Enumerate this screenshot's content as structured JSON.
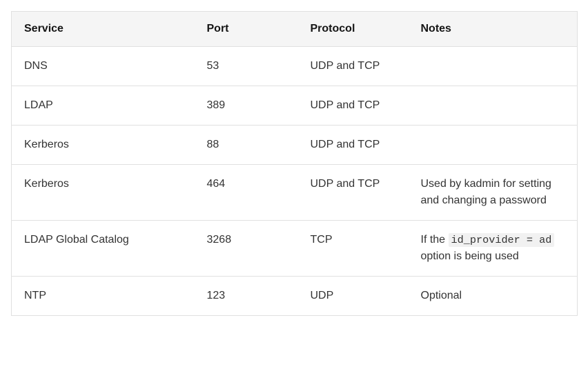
{
  "table": {
    "headers": {
      "service": "Service",
      "port": "Port",
      "protocol": "Protocol",
      "notes": "Notes"
    },
    "rows": {
      "r0": {
        "service": "DNS",
        "port": "53",
        "protocol": "UDP and TCP",
        "notes": ""
      },
      "r1": {
        "service": "LDAP",
        "port": "389",
        "protocol": "UDP and TCP",
        "notes": ""
      },
      "r2": {
        "service": "Kerberos",
        "port": "88",
        "protocol": "UDP and TCP",
        "notes": ""
      },
      "r3": {
        "service": "Kerberos",
        "port": "464",
        "protocol": "UDP and TCP",
        "notes": "Used by kadmin for setting and changing a password"
      },
      "r4": {
        "service": "LDAP Global Catalog",
        "port": "3268",
        "protocol": "TCP",
        "notes_prefix": "If the ",
        "notes_code": "id_provider = ad",
        "notes_suffix": " option is being used"
      },
      "r5": {
        "service": "NTP",
        "port": "123",
        "protocol": "UDP",
        "notes": "Optional"
      }
    }
  }
}
